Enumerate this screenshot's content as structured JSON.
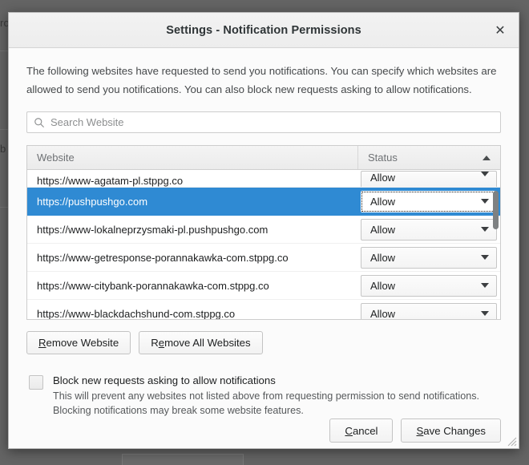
{
  "backdrop": {
    "fragment_1": "ro",
    "fragment_2": "b"
  },
  "dialog": {
    "title": "Settings - Notification Permissions",
    "close_icon": "close-icon",
    "description": "The following websites have requested to send you notifications. You can specify which websites are allowed to send you notifications. You can also block new requests asking to allow notifications."
  },
  "search": {
    "placeholder": "Search Website",
    "value": "",
    "icon": "search-icon"
  },
  "table": {
    "columns": [
      "Website",
      "Status"
    ],
    "sort": {
      "column": "Status",
      "direction": "ascending",
      "icon": "triangle-up-icon"
    },
    "rows": [
      {
        "website": "https://www-agatam-pl.stppg.co",
        "status": "Allow",
        "selected": false,
        "clipped": true
      },
      {
        "website": "https://pushpushgo.com",
        "status": "Allow",
        "selected": true,
        "clipped": false
      },
      {
        "website": "https://www-lokalneprzysmaki-pl.pushpushgo.com",
        "status": "Allow",
        "selected": false,
        "clipped": false
      },
      {
        "website": "https://www-getresponse-porannakawka-com.stppg.co",
        "status": "Allow",
        "selected": false,
        "clipped": false
      },
      {
        "website": "https://www-citybank-porannakawka-com.stppg.co",
        "status": "Allow",
        "selected": false,
        "clipped": false
      },
      {
        "website": "https://www-blackdachshund-com.stppg.co",
        "status": "Allow",
        "selected": false,
        "clipped": false
      }
    ],
    "scrollbar": {
      "name": "vertical-scrollbar"
    }
  },
  "actions": {
    "remove_website": {
      "pre": "",
      "mnemonic": "R",
      "post": "emove Website"
    },
    "remove_all": {
      "pre": "R",
      "mnemonic": "e",
      "post": "move All Websites"
    }
  },
  "block_option": {
    "checked": false,
    "label": "Block new requests asking to allow notifications",
    "description_line_1": "This will prevent any websites not listed above from requesting permission to send notifications.",
    "description_line_2": "Blocking notifications may break some website features."
  },
  "footer": {
    "cancel": {
      "pre": "",
      "mnemonic": "C",
      "post": "ancel"
    },
    "save": {
      "pre": "",
      "mnemonic": "S",
      "post": "ave Changes"
    }
  },
  "colors": {
    "selection_blue": "#2f8ad3",
    "dialog_bg": "#fbfbfb",
    "titlebar_bg": "#f0f0f0",
    "backdrop": "#646464",
    "text": "#1d1f20"
  }
}
